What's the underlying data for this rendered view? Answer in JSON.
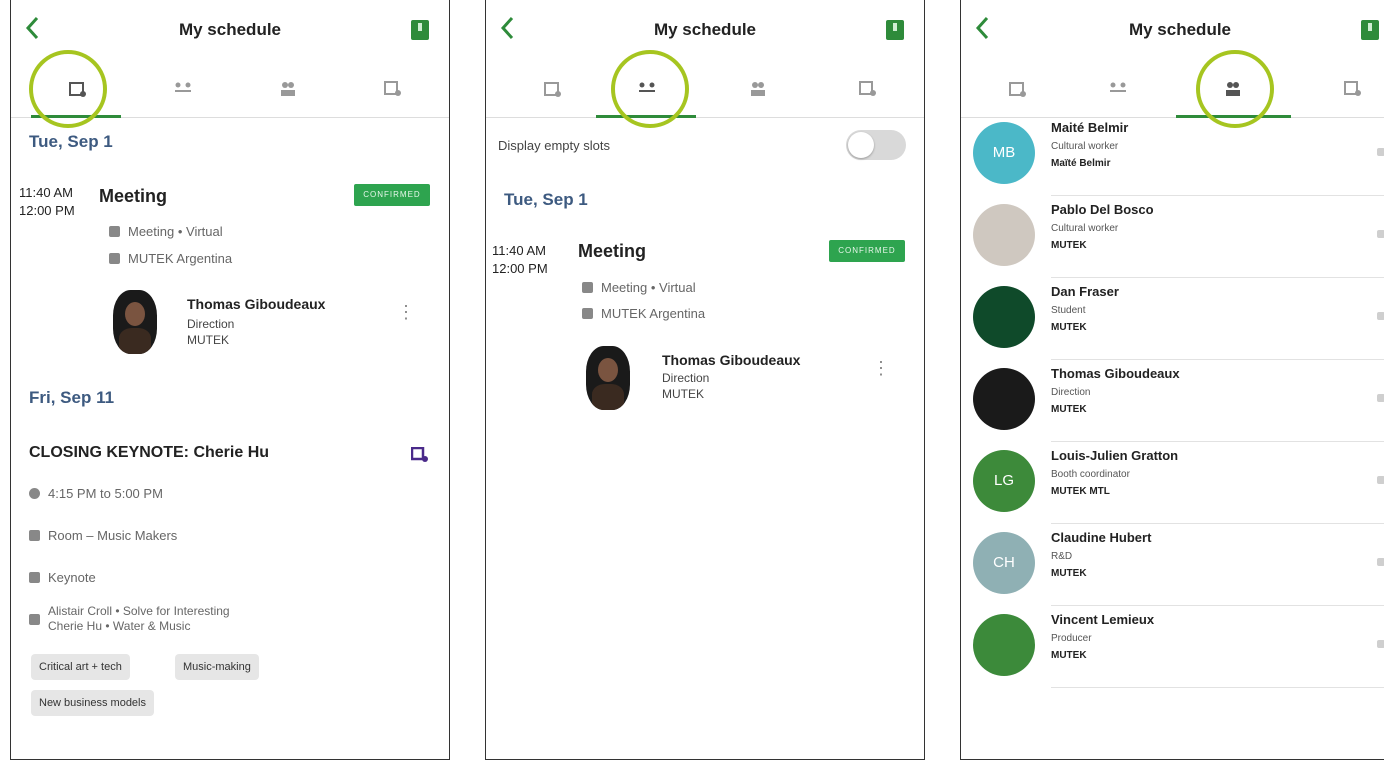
{
  "title": "My schedule",
  "colors": {
    "accent": "#2e8b3a",
    "highlight_ring": "#a6c520",
    "confirmed": "#2ea44f",
    "date": "#3d5a80"
  },
  "tab_icons": [
    "calendar-check-icon",
    "meeting-icon",
    "people-icon",
    "calendar-person-icon"
  ],
  "screen1": {
    "date1": "Tue, Sep 1",
    "time_start": "11:40 AM",
    "time_end": "12:00 PM",
    "event_title": "Meeting",
    "status": "CONFIRMED",
    "meta1": "Meeting • Virtual",
    "meta2": "MUTEK Argentina",
    "person_name": "Thomas Giboudeaux",
    "person_role": "Direction",
    "person_org": "MUTEK",
    "date2": "Fri, Sep 11",
    "keynote_title": "CLOSING KEYNOTE: Cherie Hu",
    "keynote_time": "4:15 PM to 5:00 PM",
    "keynote_room": "Room – Music Makers",
    "keynote_type": "Keynote",
    "keynote_speakers_1": "Alistair Croll • Solve for Interesting",
    "keynote_speakers_2": "Cherie Hu • Water & Music",
    "tags": [
      "Critical art + tech",
      "Music-making",
      "New business models"
    ]
  },
  "screen2": {
    "empty_slots_label": "Display empty slots",
    "date1": "Tue, Sep 1",
    "time_start": "11:40 AM",
    "time_end": "12:00 PM",
    "event_title": "Meeting",
    "status": "CONFIRMED",
    "meta1": "Meeting • Virtual",
    "meta2": "MUTEK Argentina",
    "person_name": "Thomas Giboudeaux",
    "person_role": "Direction",
    "person_org": "MUTEK"
  },
  "screen3": {
    "contacts": [
      {
        "name": "Maité Belmir",
        "role": "Cultural worker",
        "org": "Maïté Belmir",
        "initials": "MB",
        "color": "#4bb8c8"
      },
      {
        "name": "Pablo Del Bosco",
        "role": "Cultural worker",
        "org": "MUTEK",
        "initials": "",
        "color": "#cfc8c0"
      },
      {
        "name": "Dan Fraser",
        "role": "Student",
        "org": "MUTEK",
        "initials": "",
        "color": "#0f4a2a"
      },
      {
        "name": "Thomas Giboudeaux",
        "role": "Direction",
        "org": "MUTEK",
        "initials": "",
        "color": "#1a1a1a"
      },
      {
        "name": "Louis-Julien Gratton",
        "role": "Booth coordinator",
        "org": "MUTEK MTL",
        "initials": "LG",
        "color": "#3d8a3a"
      },
      {
        "name": "Claudine Hubert",
        "role": "R&D",
        "org": "MUTEK",
        "initials": "CH",
        "color": "#8fb0b4"
      },
      {
        "name": "Vincent Lemieux",
        "role": "Producer",
        "org": "MUTEK",
        "initials": "",
        "color": "#3c8a3a"
      }
    ]
  }
}
